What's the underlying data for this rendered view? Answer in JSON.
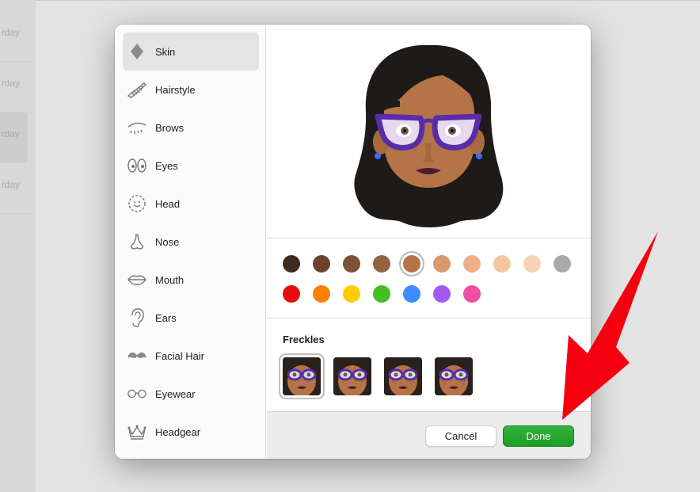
{
  "background": {
    "rows": [
      "rday",
      "rday",
      "rday",
      "rday"
    ]
  },
  "sidebar": {
    "items": [
      {
        "label": "Skin",
        "icon": "skin-diamond-icon",
        "active": true
      },
      {
        "label": "Hairstyle",
        "icon": "comb-icon"
      },
      {
        "label": "Brows",
        "icon": "brows-icon"
      },
      {
        "label": "Eyes",
        "icon": "eyes-icon"
      },
      {
        "label": "Head",
        "icon": "head-icon"
      },
      {
        "label": "Nose",
        "icon": "nose-icon"
      },
      {
        "label": "Mouth",
        "icon": "mouth-icon"
      },
      {
        "label": "Ears",
        "icon": "ear-icon"
      },
      {
        "label": "Facial Hair",
        "icon": "mustache-icon"
      },
      {
        "label": "Eyewear",
        "icon": "glasses-icon"
      },
      {
        "label": "Headgear",
        "icon": "crown-icon"
      }
    ]
  },
  "skin_colors": {
    "row1": [
      "#3f2a22",
      "#6a4330",
      "#7e5236",
      "#94623f",
      "#b57447",
      "#d9996d",
      "#eeb088",
      "#f4c7a3",
      "#f8d2b4",
      "#a9a9a9"
    ],
    "row2": [
      "#e50d0d",
      "#ff7f00",
      "#ffcc00",
      "#44bf1f",
      "#3d8bff",
      "#a259ef",
      "#ef4fa0"
    ],
    "selected_index": 4
  },
  "freckles": {
    "title": "Freckles",
    "options": [
      "freckles-none",
      "freckles-light",
      "freckles-medium",
      "freckles-heavy"
    ],
    "selected_index": 0
  },
  "footer": {
    "cancel_label": "Cancel",
    "done_label": "Done"
  },
  "colors": {
    "done_green": "#24a52b",
    "annotation_arrow": "#f4000f"
  }
}
